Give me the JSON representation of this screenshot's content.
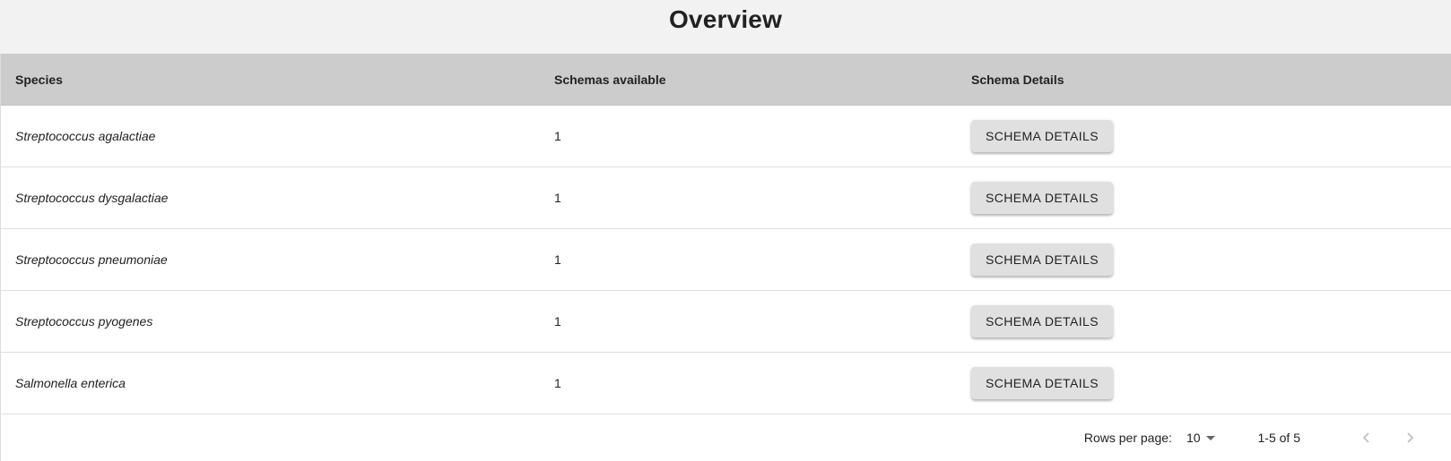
{
  "page": {
    "title": "Overview"
  },
  "table": {
    "columns": [
      "Species",
      "Schemas available",
      "Schema Details"
    ],
    "rows": [
      {
        "species": "Streptococcus agalactiae",
        "schemas": "1",
        "action_label": "SCHEMA DETAILS"
      },
      {
        "species": "Streptococcus dysgalactiae",
        "schemas": "1",
        "action_label": "SCHEMA DETAILS"
      },
      {
        "species": "Streptococcus pneumoniae",
        "schemas": "1",
        "action_label": "SCHEMA DETAILS"
      },
      {
        "species": "Streptococcus pyogenes",
        "schemas": "1",
        "action_label": "SCHEMA DETAILS"
      },
      {
        "species": "Salmonella enterica",
        "schemas": "1",
        "action_label": "SCHEMA DETAILS"
      }
    ]
  },
  "pagination": {
    "rows_per_page_label": "Rows per page:",
    "rows_per_page_value": "10",
    "range_label": "1-5 of 5",
    "prev_icon": "chevron-left-icon",
    "next_icon": "chevron-right-icon"
  },
  "colors": {
    "background": "#f2f2f2",
    "header_bg": "#cccccc",
    "button_bg": "#e0e0e0",
    "text": "#222222"
  }
}
